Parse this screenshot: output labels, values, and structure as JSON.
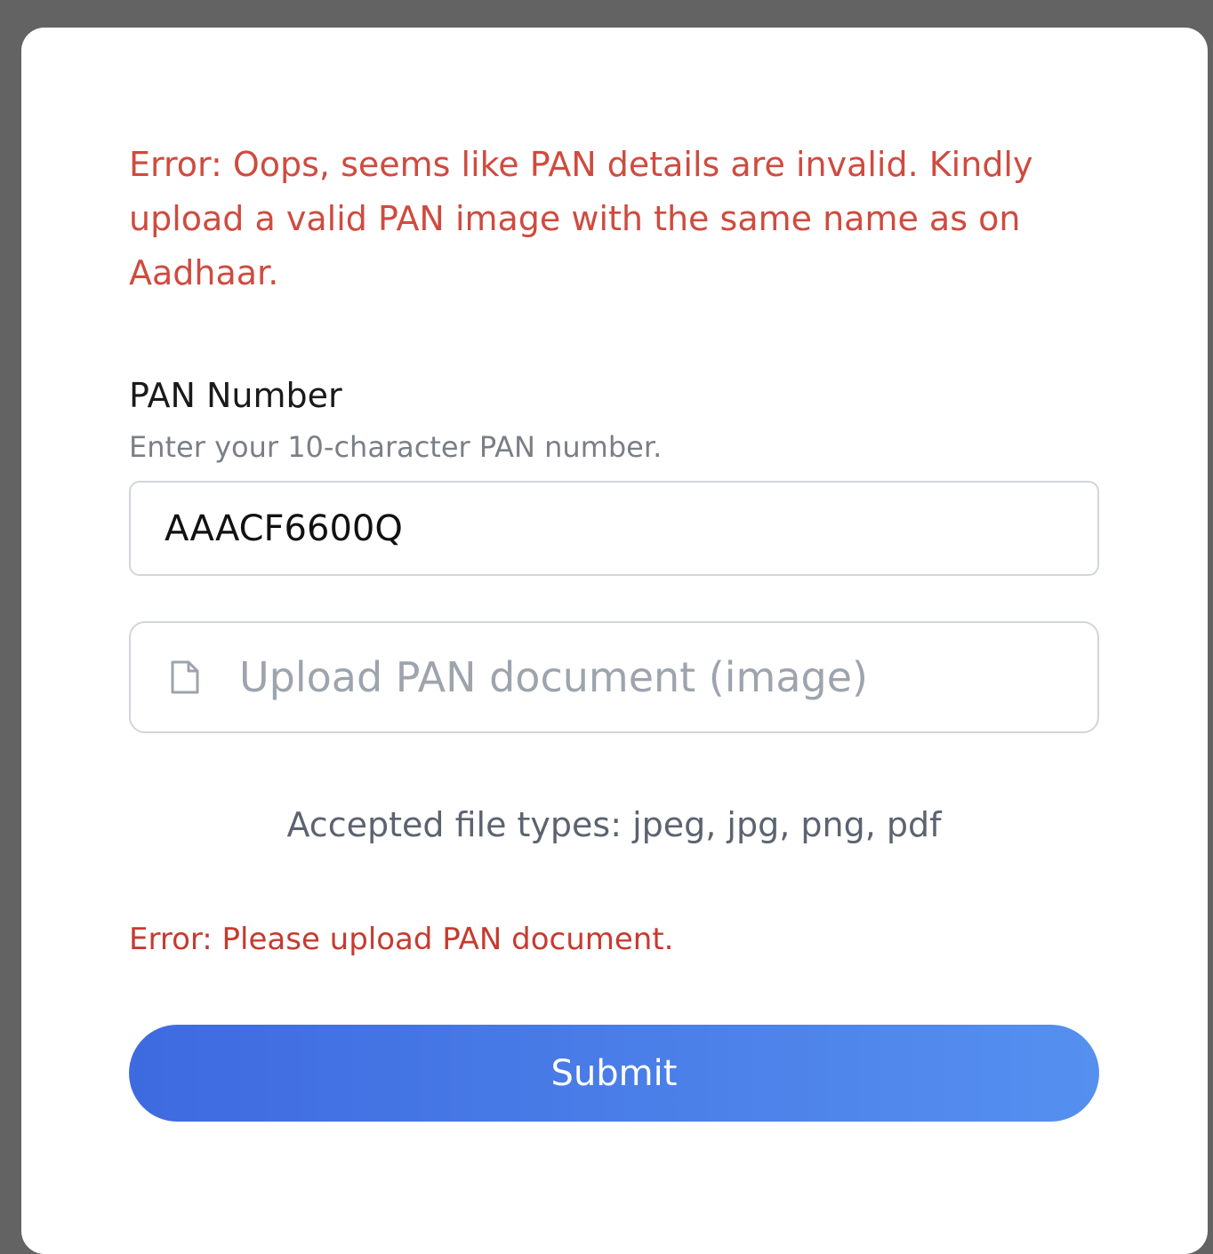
{
  "form": {
    "error_main": "Error: Oops, seems like PAN details are invalid. Kindly upload a valid PAN image with the same name as on Aadhaar.",
    "pan_label": "PAN Number",
    "pan_helper": "Enter your 10-character PAN number.",
    "pan_value": "AAACF6600Q",
    "upload_placeholder": "Upload PAN document (image)",
    "accepted_types": "Accepted file types: jpeg, jpg, png, pdf",
    "error_upload": "Error: Please upload PAN document.",
    "submit_label": "Submit"
  },
  "colors": {
    "backdrop": "#636363",
    "error": "#cf4b3f",
    "button_gradient_start": "#3e6ae0",
    "button_gradient_end": "#5590ef"
  },
  "icons": {
    "upload": "file-icon"
  }
}
